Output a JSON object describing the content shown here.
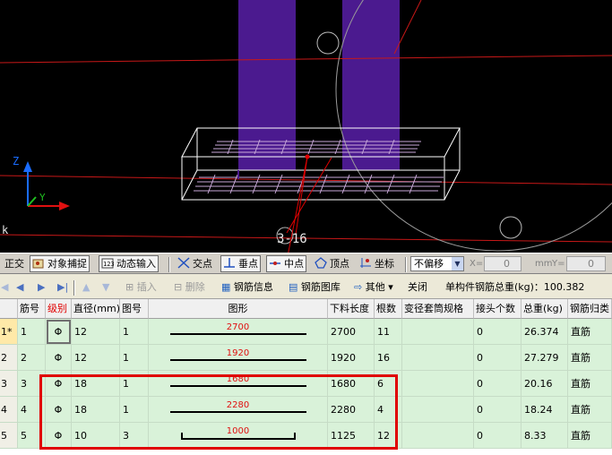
{
  "viewport": {
    "section_label": "3-16",
    "axis_z": "Z",
    "axis_y": "Y",
    "left_marker": "k"
  },
  "toolbar1": {
    "items": [
      {
        "label": "正交",
        "icon": ""
      },
      {
        "label": "对象捕捉",
        "icon": "snap-icon"
      },
      {
        "label": "动态输入",
        "icon": "dynamic-input-icon"
      },
      {
        "label": "交点",
        "icon": "intersection-icon"
      },
      {
        "label": "垂点",
        "icon": "perpendicular-icon"
      },
      {
        "label": "中点",
        "icon": "midpoint-icon"
      },
      {
        "label": "顶点",
        "icon": "vertex-icon"
      },
      {
        "label": "坐标",
        "icon": "coordinate-icon"
      }
    ],
    "offset_mode": "不偏移",
    "x_label": "X=",
    "x_value": "0",
    "x_unit": "mm",
    "y_label": "Y=",
    "y_value": "0"
  },
  "toolbar2": {
    "insert": "插入",
    "delete": "删除",
    "rebar_info": "钢筋信息",
    "rebar_library": "钢筋图库",
    "other": "其他",
    "close": "关闭",
    "total_weight_label": "单构件钢筋总重(kg)：100.382"
  },
  "table": {
    "columns": [
      "筋号",
      "级别",
      "直径(mm)",
      "图号",
      "图形",
      "下料长度",
      "根数",
      "变径套筒规格",
      "接头个数",
      "总重(kg)",
      "钢筋归类"
    ],
    "rows": [
      {
        "rowhead": "1*",
        "bar_no": "1",
        "grade": "Φ",
        "diameter": "12",
        "shape_no": "1",
        "shape_dim": "2700",
        "shape_type": "straight",
        "cut_length": "2700",
        "count": "11",
        "sleeve": "",
        "joints": "0",
        "weight": "26.374",
        "category": "直筋"
      },
      {
        "rowhead": "2",
        "bar_no": "2",
        "grade": "Φ",
        "diameter": "12",
        "shape_no": "1",
        "shape_dim": "1920",
        "shape_type": "straight",
        "cut_length": "1920",
        "count": "16",
        "sleeve": "",
        "joints": "0",
        "weight": "27.279",
        "category": "直筋"
      },
      {
        "rowhead": "3",
        "bar_no": "3",
        "grade": "Φ",
        "diameter": "18",
        "shape_no": "1",
        "shape_dim": "1680",
        "shape_type": "straight",
        "cut_length": "1680",
        "count": "6",
        "sleeve": "",
        "joints": "0",
        "weight": "20.16",
        "category": "直筋"
      },
      {
        "rowhead": "4",
        "bar_no": "4",
        "grade": "Φ",
        "diameter": "18",
        "shape_no": "1",
        "shape_dim": "2280",
        "shape_type": "straight",
        "cut_length": "2280",
        "count": "4",
        "sleeve": "",
        "joints": "0",
        "weight": "18.24",
        "category": "直筋"
      },
      {
        "rowhead": "5",
        "bar_no": "5",
        "grade": "Φ",
        "diameter": "10",
        "shape_no": "3",
        "shape_dim": "1000",
        "shape_type": "hooked",
        "cut_length": "1125",
        "count": "12",
        "sleeve": "",
        "joints": "0",
        "weight": "8.33",
        "category": "直筋"
      }
    ]
  },
  "colors": {
    "viewport_bg": "#000000",
    "grid_row_bg": "#d9f2d9",
    "highlight_box": "#e00000",
    "column_purple": "#4b1a8f"
  }
}
